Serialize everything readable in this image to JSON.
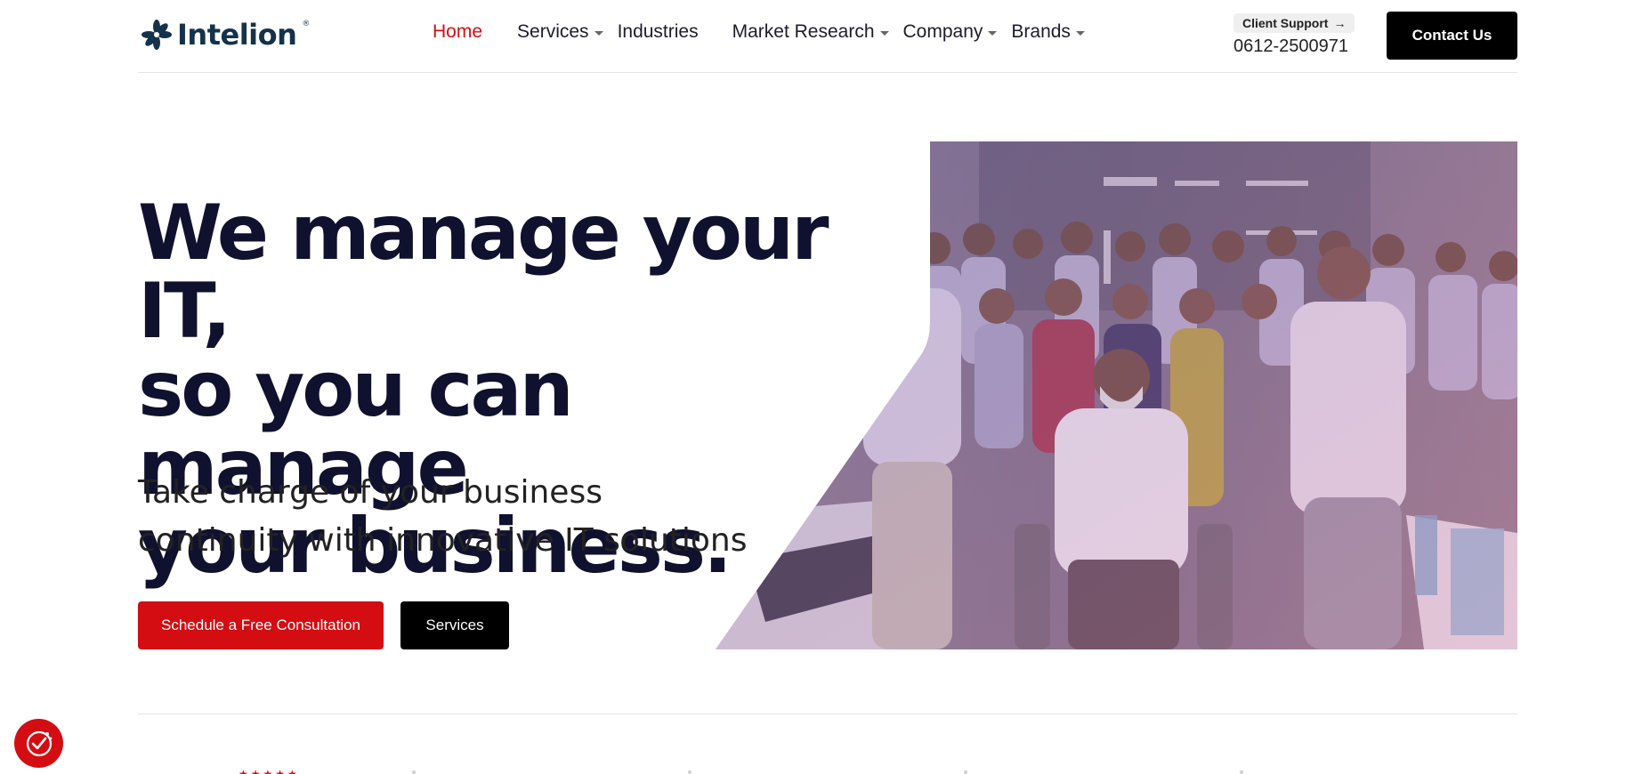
{
  "brand": {
    "name": "Intelion",
    "reg_mark": "®",
    "color": "#14324a"
  },
  "nav": {
    "items": [
      {
        "label": "Home",
        "active": true,
        "dropdown": false
      },
      {
        "label": "Services",
        "active": false,
        "dropdown": true
      },
      {
        "label": "Industries",
        "active": false,
        "dropdown": false
      },
      {
        "label": "Market Research",
        "active": false,
        "dropdown": true
      },
      {
        "label": "Company",
        "active": false,
        "dropdown": true
      },
      {
        "label": "Brands",
        "active": false,
        "dropdown": true
      }
    ],
    "active_color": "#d40d12"
  },
  "support": {
    "label": "Client Support",
    "arrow": "→",
    "phone": "0612-2500971"
  },
  "header": {
    "contact_label": "Contact Us"
  },
  "hero": {
    "title_lines": [
      "We manage your IT,",
      "so you can manage",
      "your business."
    ],
    "subtitle_lines": [
      "Take charge of your business",
      "continuity with innovative IT solutions"
    ],
    "cta_primary": "Schedule a Free Consultation",
    "cta_secondary": "Services",
    "image_alt": "Group photo of the team in the office"
  },
  "ratings": {
    "stars": "★★★★★"
  },
  "colors": {
    "accent": "#d40d12",
    "dark": "#10112e",
    "button_dark": "#000000"
  },
  "icons": {
    "cookie": "cookie-consent-icon",
    "arrow": "arrow-right-icon",
    "caret": "chevron-down-icon"
  }
}
